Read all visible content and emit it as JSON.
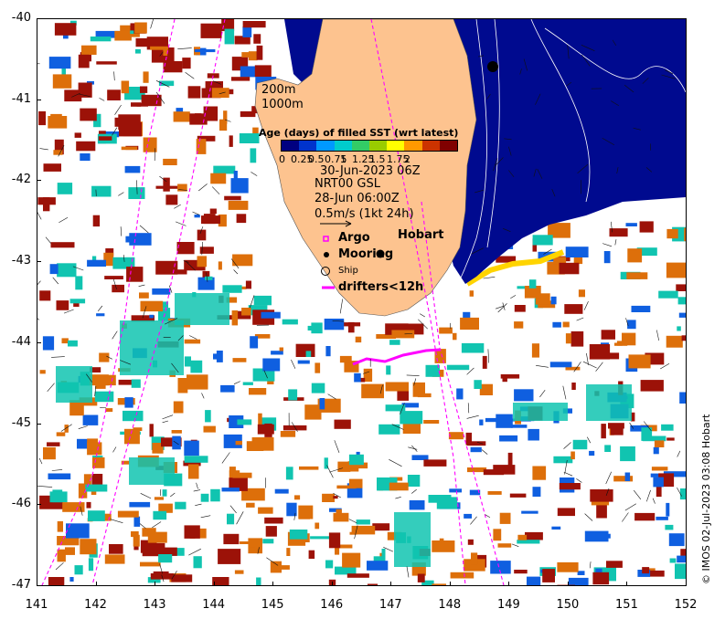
{
  "map": {
    "lon_ticks": [
      "141",
      "142",
      "143",
      "144",
      "145",
      "146",
      "147",
      "148",
      "149",
      "150",
      "151",
      "152"
    ],
    "lat_ticks": [
      "-40",
      "-41",
      "-42",
      "-43",
      "-44",
      "-45",
      "-46",
      "-47"
    ],
    "lon_range": [
      141,
      152
    ],
    "lat_range": [
      -47,
      -40
    ]
  },
  "legend": {
    "iso_200": "200m",
    "iso_1000": "1000m",
    "colorbar_title": "Age (days) of filled SST (wrt latest)",
    "colorbar_ticks": [
      "0",
      "0.25",
      "0.5",
      "0.75",
      "1",
      "1.25",
      "1.5",
      "1.75",
      "2"
    ],
    "colorbar_colors": [
      "#000080",
      "#0033cc",
      "#0099ff",
      "#00cccc",
      "#33cc66",
      "#99cc00",
      "#ffff00",
      "#ff9900",
      "#cc3300",
      "#800000"
    ],
    "sst_time": "30-Jun-2023 06Z",
    "product": "NRT00 GSL",
    "product_time": "28-Jun 06:00Z",
    "scale_text": "0.5m/s (1kt 24h)",
    "argo": "Argo",
    "mooring": "Mooring",
    "ship": "Ship",
    "drifters": "drifters<12h"
  },
  "places": {
    "hobart": "Hobart"
  },
  "credit": "© IMOS 02-Jul-2023 03:08 Hobart",
  "colors": {
    "land": "#fdc38f",
    "deep_blue": "#000a8f",
    "orange": "#dd6f0a",
    "teal": "#11c4b0",
    "brown_red": "#9c1208",
    "blue": "#0f5fe0",
    "drifter": "#ff00ff"
  }
}
